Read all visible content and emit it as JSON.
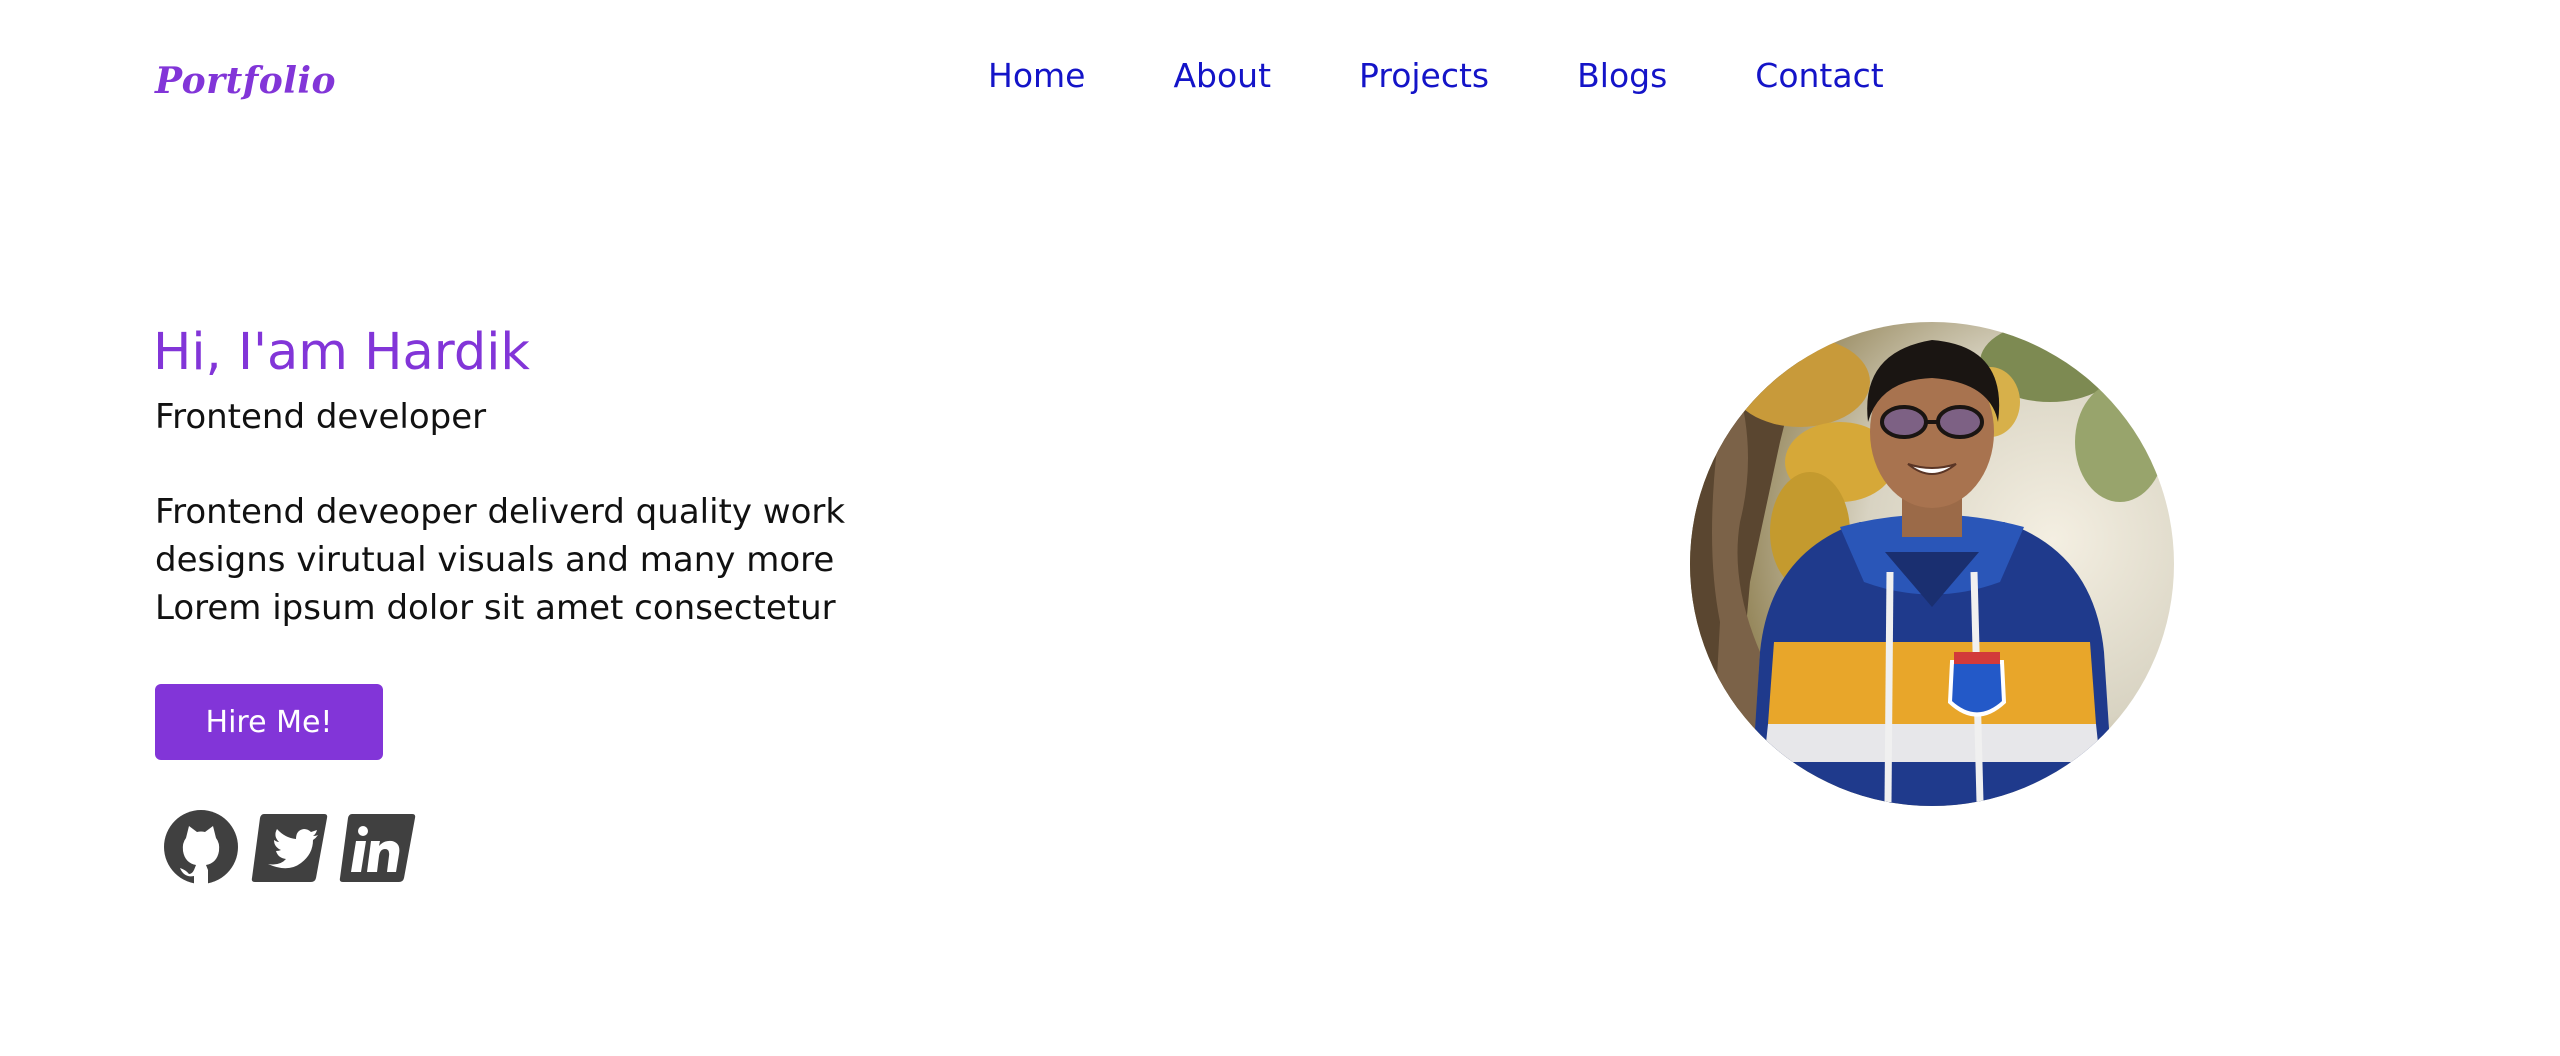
{
  "header": {
    "logo": "Portfolio",
    "nav": [
      "Home",
      "About",
      "Projects",
      "Blogs",
      "Contact"
    ]
  },
  "hero": {
    "title": "Hi, I'am Hardik",
    "role": "Frontend developer",
    "description_lines": [
      "Frontend deveoper deliverd quality work",
      "designs virutual visuals and many more",
      "Lorem ipsum dolor sit amet consectetur"
    ],
    "cta_label": "Hire Me!"
  },
  "social": {
    "icons": [
      "github-icon",
      "twitter-icon",
      "linkedin-icon"
    ]
  },
  "colors": {
    "accent": "#8235d8",
    "nav_text": "#1414c8",
    "body_text": "#111111",
    "icon": "#404040"
  }
}
